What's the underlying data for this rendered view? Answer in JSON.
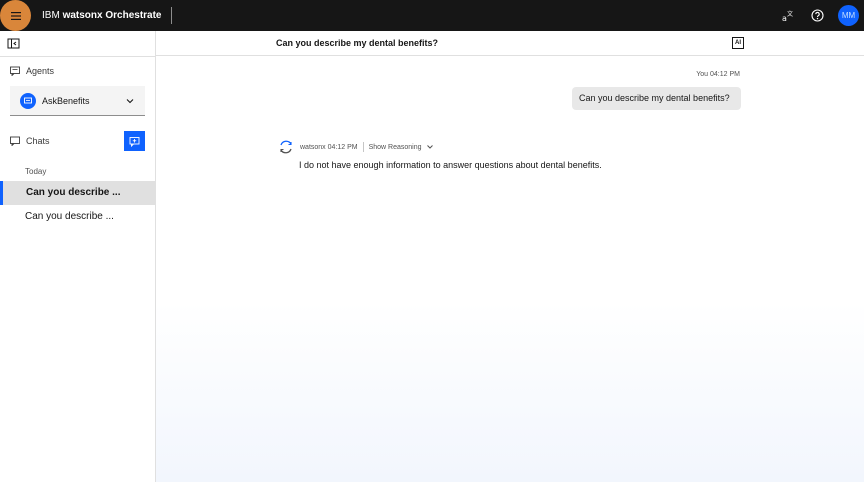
{
  "header": {
    "brand_prefix": "IBM",
    "brand_name": "watsonx Orchestrate",
    "avatar_initials": "MM"
  },
  "sidebar": {
    "agents_label": "Agents",
    "selected_agent": "AskBenefits",
    "chats_label": "Chats",
    "group_label": "Today",
    "chats": [
      {
        "label": "Can you describe ..."
      },
      {
        "label": "Can you describe ..."
      }
    ]
  },
  "conversation": {
    "title": "Can you describe my dental benefits?",
    "ai_badge": "AI",
    "user_meta": "You 04:12 PM",
    "user_message": "Can you describe my dental benefits?",
    "bot_meta": "watsonx 04:12 PM",
    "show_reasoning": "Show Reasoning",
    "bot_message": "I do not have enough information to answer questions about dental benefits."
  },
  "colors": {
    "accent": "#0f62fe",
    "header_bg": "#161616",
    "menu_highlight": "#d9863a"
  }
}
